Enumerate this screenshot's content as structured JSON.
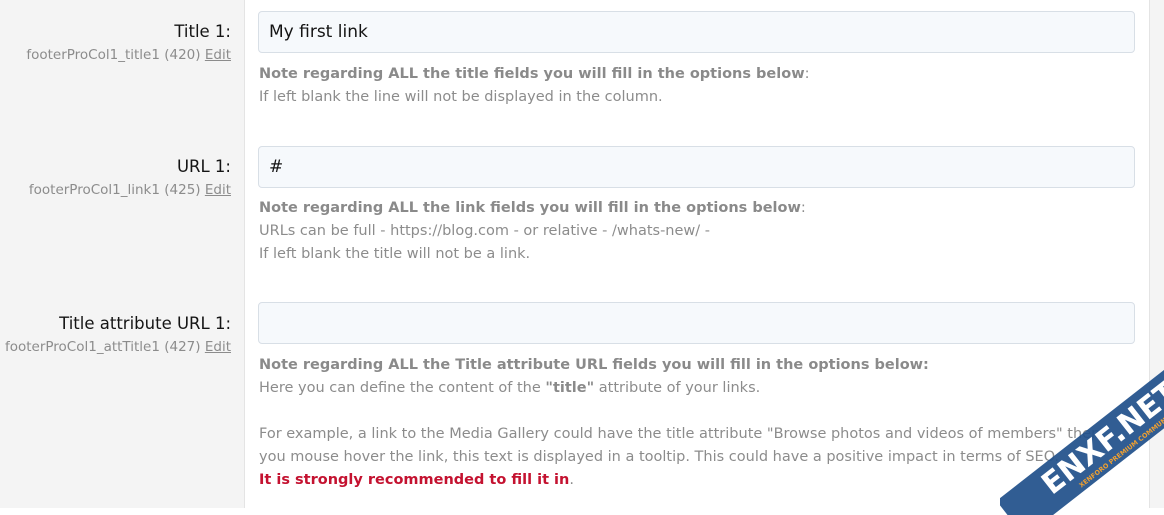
{
  "fields": [
    {
      "label": "Title 1:",
      "option_id": "footerProCol1_title1 (420)",
      "edit_label": "Edit",
      "value": "My first link",
      "note_bold": "Note regarding ALL the title fields you will fill in the options below",
      "note_suffix": ":",
      "note_lines": [
        "If left blank the line will not be displayed in the column."
      ]
    },
    {
      "label": "URL 1:",
      "option_id": "footerProCol1_link1 (425)",
      "edit_label": "Edit",
      "value": "#",
      "note_bold": "Note regarding ALL the link fields you will fill in the options below",
      "note_suffix": ":",
      "note_lines": [
        "URLs can be full - https://blog.com - or relative - /whats-new/ -",
        "If left blank the title will not be a link."
      ]
    },
    {
      "label": "Title attribute URL 1:",
      "option_id": "footerProCol1_attTitle1 (427)",
      "edit_label": "Edit",
      "value": "",
      "note_bold": "Note regarding ALL the Title attribute URL fields you will fill in the options below:",
      "note_line1_prefix": "Here you can define the content of the ",
      "note_line1_bold": "\"title\"",
      "note_line1_suffix": " attribute of your links.",
      "note_para2_line1": "For example, a link to the Media Gallery could have the title attribute \"Browse photos and videos of members\" then",
      "note_para2_line2": "you mouse hover the link, this text is displayed in a tooltip. This could have a positive impact in terms of SEO.",
      "note_warning": "It is strongly recommended to fill it in",
      "note_warning_suffix": "."
    }
  ],
  "watermark": {
    "text": "ENXF.NET",
    "subtext": "XENFORO PREMIUM COMMUNITY"
  },
  "colors": {
    "label_bg": "#f4f4f4",
    "input_bg": "#f6f9fc",
    "input_border": "#d8dfe6",
    "hint_text": "#8c8c8c",
    "warning": "#c41230",
    "watermark_band": "#1f4f8a"
  }
}
